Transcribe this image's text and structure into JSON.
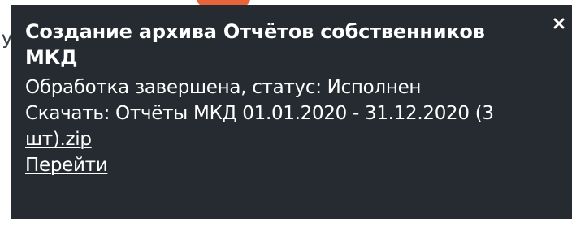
{
  "notification": {
    "title": "Создание архива Отчётов собственников МКД",
    "status_text": "Обработка завершена, статус: Исполнен",
    "download_label": "Скачать: ",
    "download_link": "Отчёты МКД 01.01.2020 - 31.12.2020 (3 шт).zip",
    "goto_link": "Перейти",
    "close_icon": "close-icon"
  },
  "background": {
    "partial_glyph": "У"
  },
  "colors": {
    "toast_bg": "#252b30",
    "text": "#ffffff",
    "accent": "#e8643a",
    "page_bg": "#ffffff"
  }
}
